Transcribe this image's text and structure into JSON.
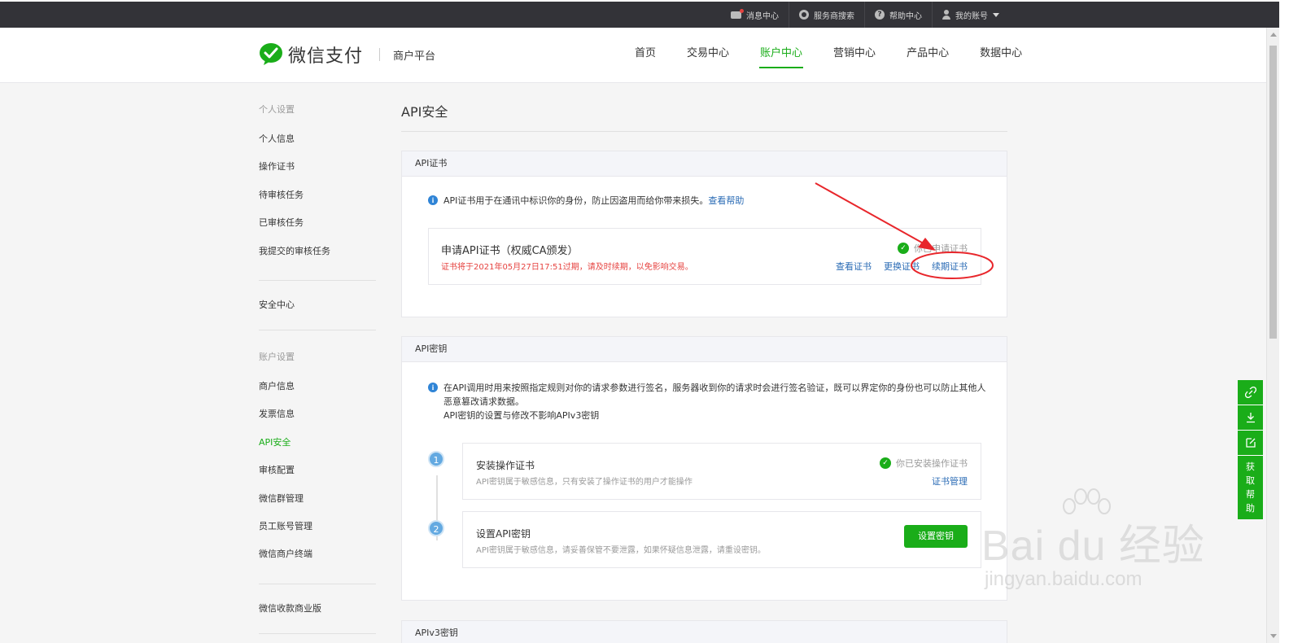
{
  "topbar": {
    "messages": "消息中心",
    "provider_search": "服务商搜索",
    "help_center": "帮助中心",
    "my_account": "我的账号"
  },
  "header": {
    "logo_text": "微信支付",
    "platform": "商户平台",
    "nav": [
      {
        "label": "首页"
      },
      {
        "label": "交易中心"
      },
      {
        "label": "账户中心"
      },
      {
        "label": "营销中心"
      },
      {
        "label": "产品中心"
      },
      {
        "label": "数据中心"
      }
    ],
    "active_nav": "账户中心"
  },
  "sidebar": {
    "personal_title": "个人设置",
    "personal_items": [
      "个人信息",
      "操作证书",
      "待审核任务",
      "已审核任务",
      "我提交的审核任务"
    ],
    "security_center": "安全中心",
    "account_title": "账户设置",
    "account_items": [
      "商户信息",
      "发票信息",
      "API安全",
      "审核配置",
      "微信群管理",
      "员工账号管理",
      "微信商户终端"
    ],
    "active_item": "API安全",
    "bottom_item": "微信收款商业版"
  },
  "main": {
    "title": "API安全",
    "cert_panel": {
      "heading": "API证书",
      "tip": "API证书用于在通讯中标识你的身份，防止因盗用而给你带来损失。",
      "tip_link": "查看帮助",
      "apply_title": "申请API证书（权威CA颁发）",
      "warning": "证书将于2021年05月27日17:51过期，请及时续期，以免影响交易。",
      "status": "你已申请证书",
      "links": [
        "查看证书",
        "更换证书",
        "续期证书"
      ]
    },
    "key_panel": {
      "heading": "API密钥",
      "tip_line1": "在API调用时用来按照指定规则对你的请求参数进行签名，服务器收到你的请求时会进行签名验证，既可以界定你的身份也可以防止其他人",
      "tip_line2": "恶意篡改请求数据。",
      "tip_line3": "API密钥的设置与修改不影响APIv3密钥",
      "steps": [
        {
          "num": "1",
          "title": "安装操作证书",
          "desc": "API密钥属于敏感信息，只有安装了操作证书的用户才能操作",
          "status": "你已安装操作证书",
          "link": "证书管理"
        },
        {
          "num": "2",
          "title": "设置API密钥",
          "desc": "API密钥属于敏感信息，请妥善保管不要泄露，如果怀疑信息泄露，请重设密钥。",
          "button": "设置密钥"
        }
      ]
    },
    "next_panel_heading": "APIv3密钥"
  },
  "float_tools": {
    "help_label": "获取帮助"
  },
  "watermark": {
    "main": "Bai du 经验",
    "sub": "jingyan.baidu.com"
  },
  "colors": {
    "brand_green": "#1aad19",
    "link_blue": "#2a6bb5",
    "warning_red": "#e64340",
    "annotation_red": "#e8262b"
  }
}
